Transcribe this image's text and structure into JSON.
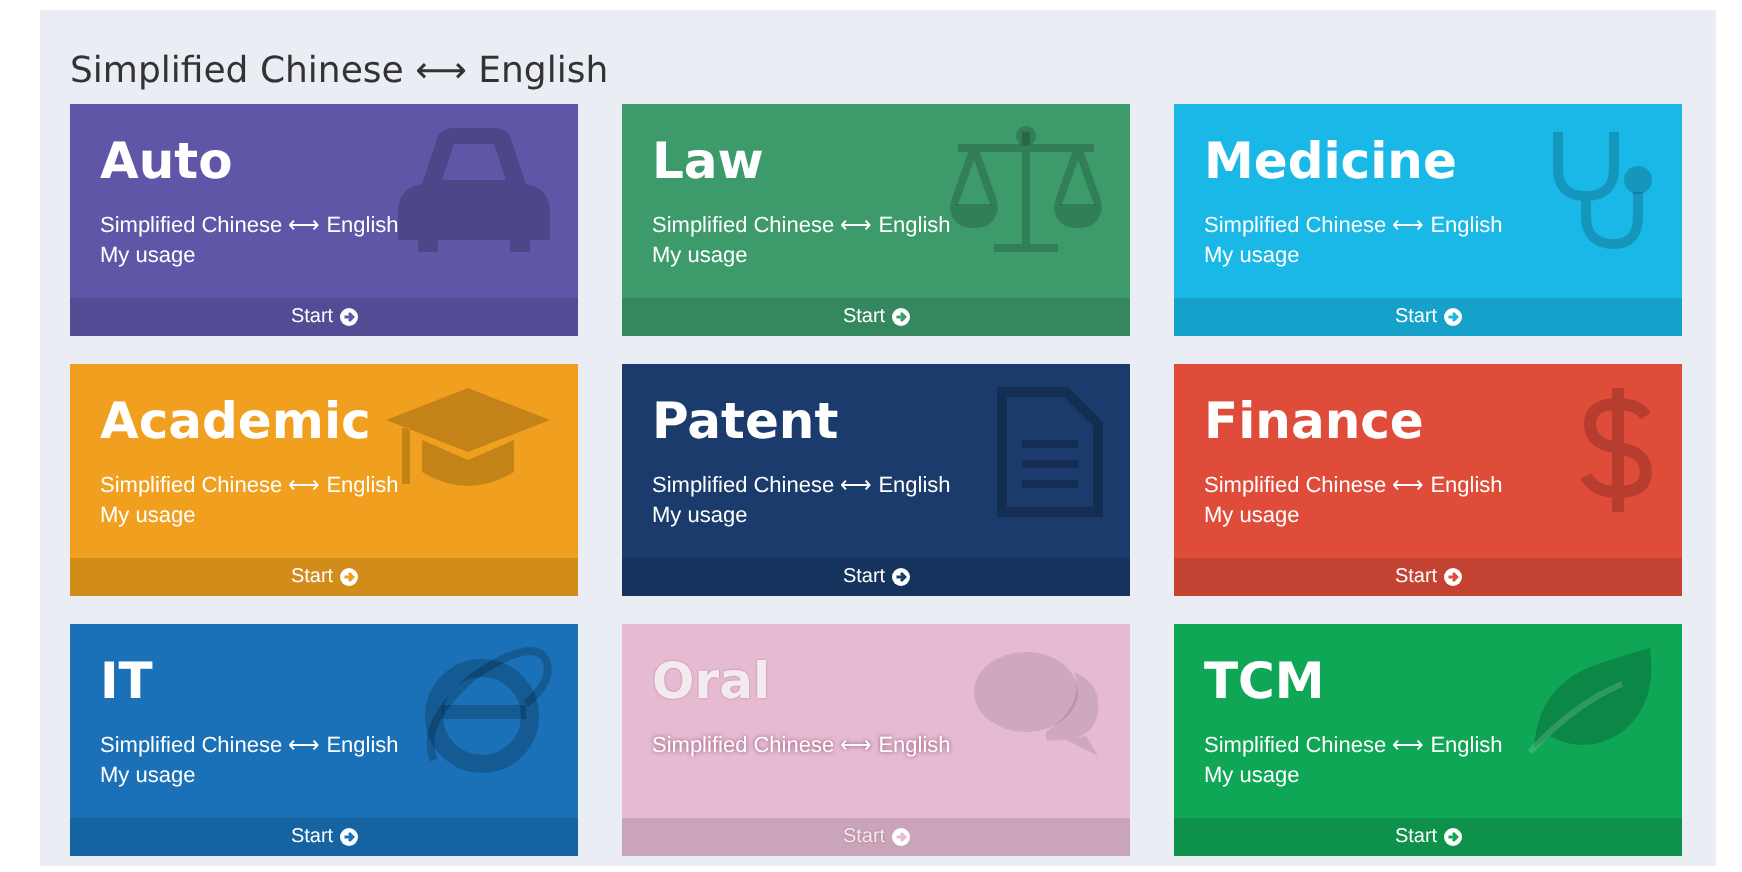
{
  "heading": "Simplified Chinese ⟷ English",
  "cards": [
    {
      "title": "Auto",
      "pair": "Simplified Chinese ⟷ English",
      "usage": "My usage",
      "button": "Start",
      "color": "#5f56a8",
      "disabled": false
    },
    {
      "title": "Law",
      "pair": "Simplified Chinese ⟷ English",
      "usage": "My usage",
      "button": "Start",
      "color": "#3d9a6a",
      "disabled": false
    },
    {
      "title": "Medicine",
      "pair": "Simplified Chinese ⟷ English",
      "usage": "My usage",
      "button": "Start",
      "color": "#1ab8e6",
      "disabled": false
    },
    {
      "title": "Academic",
      "pair": "Simplified Chinese ⟷ English",
      "usage": "My usage",
      "button": "Start",
      "color": "#f0a01e",
      "disabled": false
    },
    {
      "title": "Patent",
      "pair": "Simplified Chinese ⟷ English",
      "usage": "My usage",
      "button": "Start",
      "color": "#1a3b6b",
      "disabled": false
    },
    {
      "title": "Finance",
      "pair": "Simplified Chinese ⟷ English",
      "usage": "My usage",
      "button": "Start",
      "color": "#e04c3a",
      "disabled": false
    },
    {
      "title": "IT",
      "pair": "Simplified Chinese ⟷ English",
      "usage": "My usage",
      "button": "Start",
      "color": "#1a71b8",
      "disabled": false
    },
    {
      "title": "Oral",
      "pair": "Simplified Chinese ⟷ English",
      "button": "Start",
      "color": "#e6bbd2",
      "disabled": true
    },
    {
      "title": "TCM",
      "pair": "Simplified Chinese ⟷ English",
      "usage": "My usage",
      "button": "Start",
      "color": "#0fa656",
      "disabled": false
    }
  ]
}
